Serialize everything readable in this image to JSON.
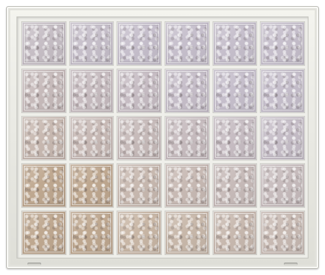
{
  "window": {
    "type": "glass block window",
    "columns": 6,
    "rows": 5,
    "frame_color": "#ecece7",
    "glass_pattern": "ice"
  },
  "palette": {
    "cool_tint": "#c6bfcc",
    "warm_tint": "#c9b59f",
    "deep_warm_tint": "#b89f86"
  },
  "icons": [
    "weep-hole-left",
    "weep-hole-right"
  ]
}
